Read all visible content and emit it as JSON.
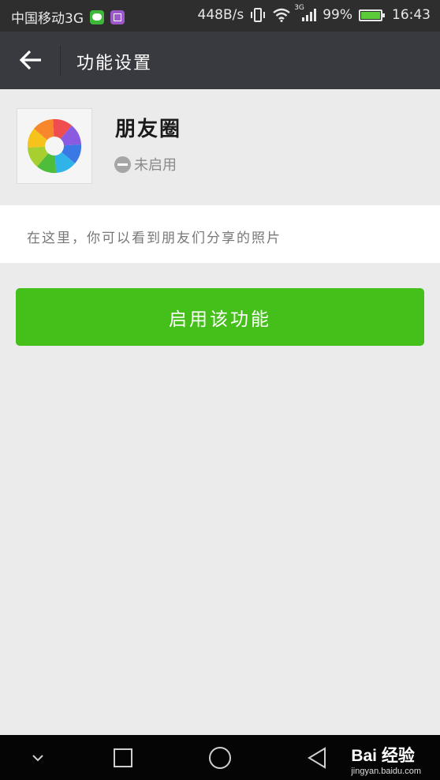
{
  "status_bar": {
    "carrier": "中国移动3G",
    "speed": "448B/s",
    "network": "3G",
    "battery": "99%",
    "time": "16:43"
  },
  "title_bar": {
    "title": "功能设置"
  },
  "feature": {
    "name": "朋友圈",
    "status": "未启用",
    "description": "在这里，你可以看到朋友们分享的照片"
  },
  "actions": {
    "enable_label": "启用该功能"
  },
  "colors": {
    "accent_green": "#45c01a",
    "titlebar_bg": "#393a3f",
    "page_bg": "#ebebeb"
  },
  "watermark": {
    "brand": "Bai 经验",
    "url": "jingyan.baidu.com"
  }
}
